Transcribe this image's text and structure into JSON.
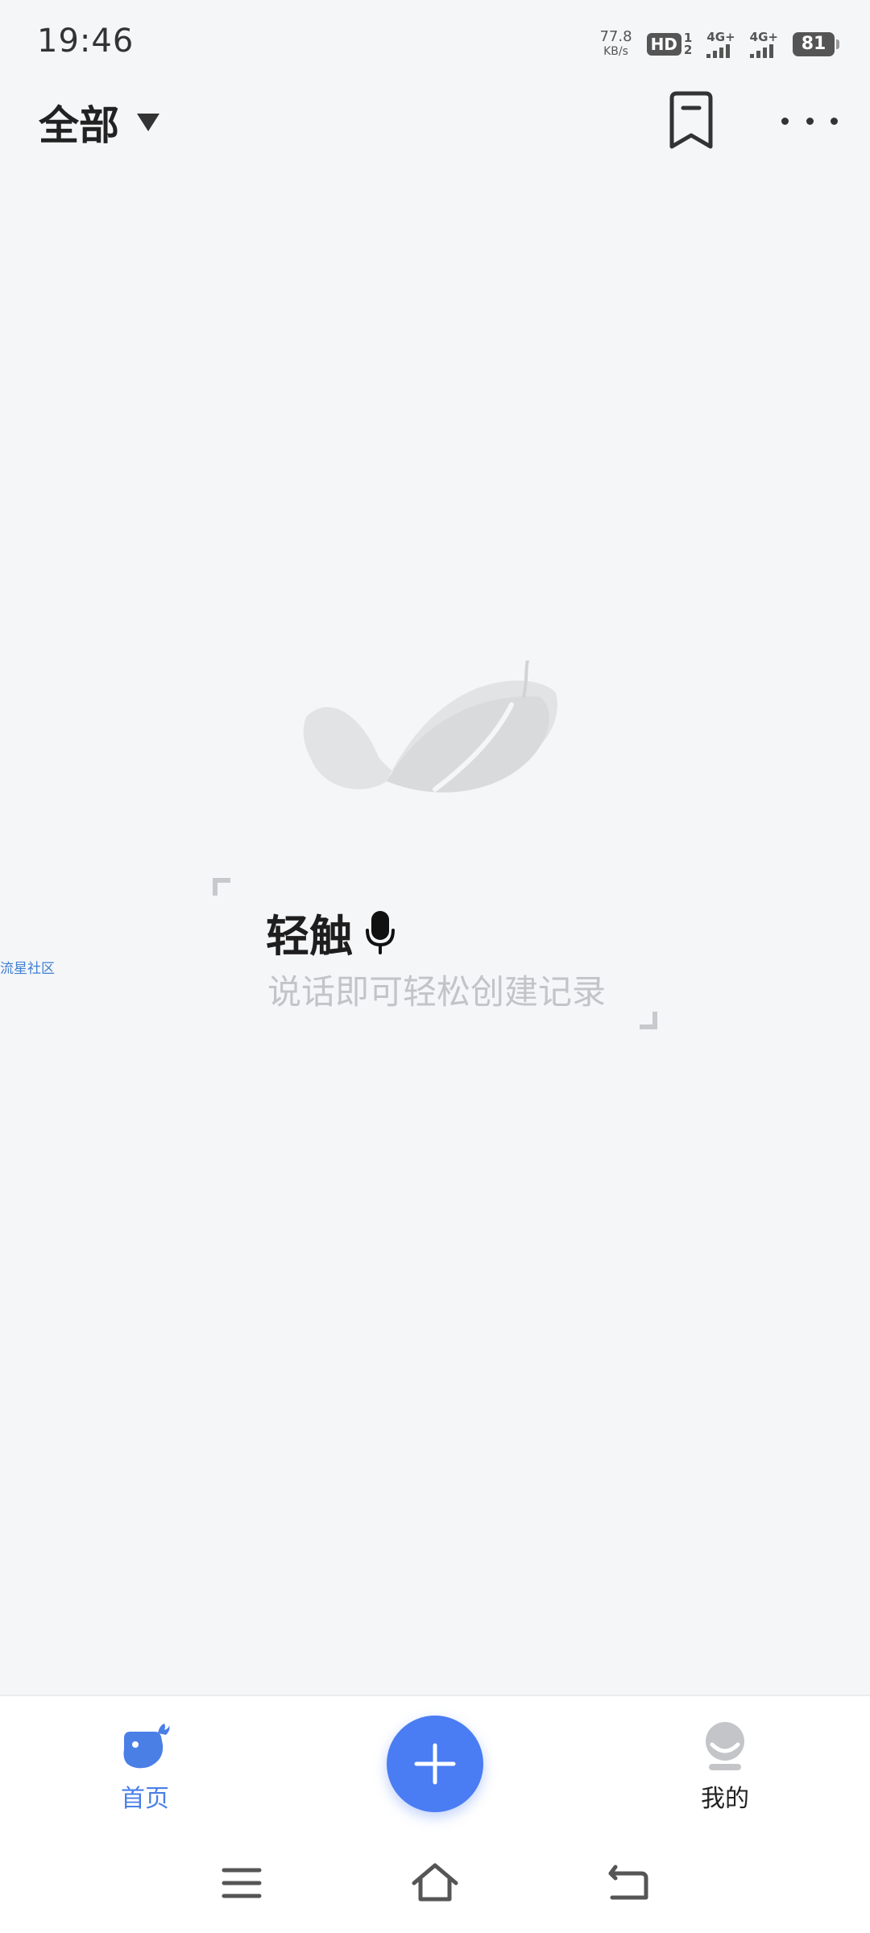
{
  "status_bar": {
    "time": "19:46",
    "net_speed_value": "77.8",
    "net_speed_unit": "KB/s",
    "hd_label": "HD",
    "hd_sub_top": "1",
    "hd_sub_bottom": "2",
    "signal1_label": "4G+",
    "signal2_label": "4G+",
    "battery": "81"
  },
  "header": {
    "filter_label": "全部",
    "icons": {
      "filter_caret": "caret-down-icon",
      "bookmark": "bookmark-icon",
      "more": "more-horizontal-icon"
    }
  },
  "empty_state": {
    "illustration": "feather-icon",
    "voice_title": "轻触",
    "voice_icon": "microphone-icon",
    "voice_subtitle": "说话即可轻松创建记录"
  },
  "side_link": "流星社区",
  "bottom_nav": {
    "home_label": "首页",
    "mine_label": "我的",
    "add_icon": "plus-icon",
    "active_color": "#4a7fe6",
    "accent_color": "#4a7cf3"
  },
  "system_nav": {
    "menu_icon": "menu-icon",
    "home_icon": "home-icon",
    "back_icon": "back-icon"
  }
}
